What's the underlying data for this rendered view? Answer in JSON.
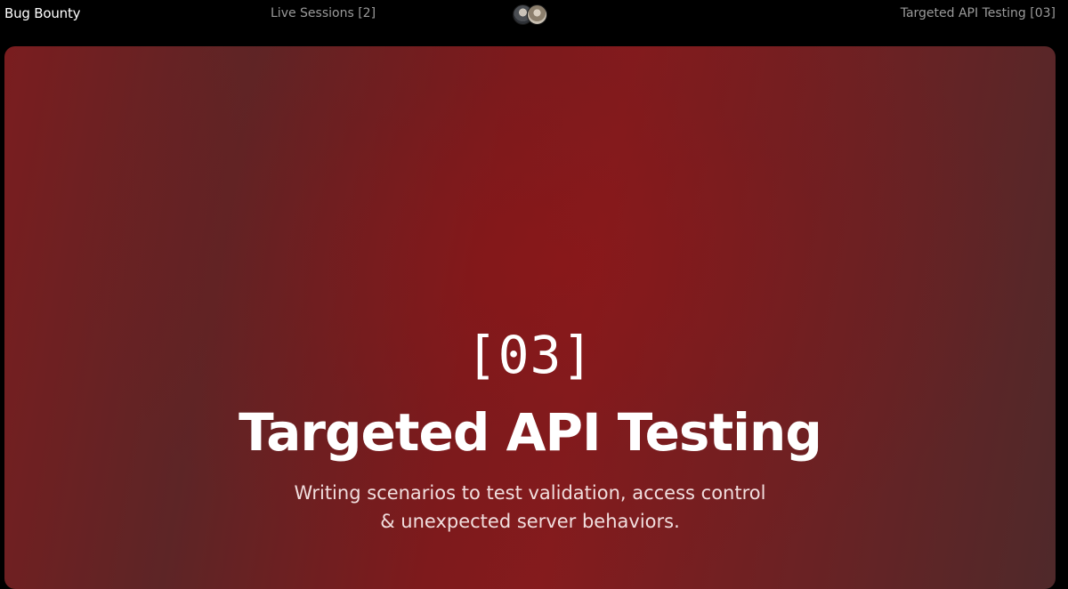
{
  "header": {
    "brand": "Bug Bounty",
    "live_sessions": "Live Sessions [2]",
    "avatars": [
      "avatar-1",
      "avatar-2"
    ],
    "section_link": "Targeted API Testing [03]"
  },
  "hero": {
    "number": "[03]",
    "title": "Targeted API Testing",
    "description_line1": "Writing scenarios to test validation, access control",
    "description_line2": "& unexpected server behaviors."
  },
  "colors": {
    "background": "#000000",
    "accent_red": "#851b1d",
    "muted_text": "#9a9a9a"
  }
}
